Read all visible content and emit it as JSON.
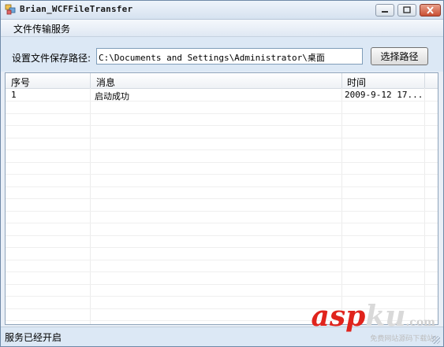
{
  "window": {
    "title": "Brian_WCFFileTransfer"
  },
  "menu": {
    "items": [
      "文件传输服务"
    ]
  },
  "path": {
    "label": "设置文件保存路径:",
    "value": "C:\\Documents and Settings\\Administrator\\桌面",
    "button": "选择路径"
  },
  "list": {
    "columns": [
      "序号",
      "消息",
      "时间"
    ],
    "rows": [
      {
        "index": "1",
        "message": "启动成功",
        "time": "2009-9-12 17..."
      }
    ]
  },
  "status": {
    "text": "服务已经开启"
  },
  "watermark": {
    "text_a": "asp",
    "text_b": "ku",
    "tld": ".com",
    "sub": "免费网站源码下载站!"
  },
  "icons": [
    "app-icon",
    "minimize-icon",
    "maximize-icon",
    "close-icon",
    "resize-grip-icon"
  ],
  "colors": {
    "title_bg": "#d6e2f0",
    "panel_bg": "#dce8f5",
    "close": "#c94f33",
    "watermark": "#e0231c"
  }
}
